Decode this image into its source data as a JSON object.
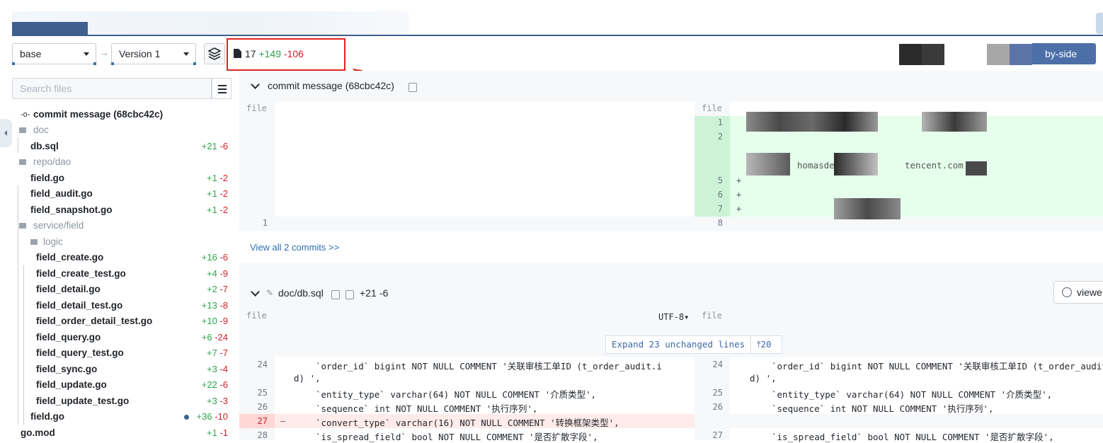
{
  "toolbar": {
    "base_select": "base",
    "version_select": "Version 1",
    "files_changed": "17",
    "additions": "+149",
    "deletions": "-106",
    "view_mode_label": "by-side"
  },
  "sidebar": {
    "search_placeholder": "Search files",
    "commit_message": "commit message (68cbc42c)",
    "items": [
      {
        "label": "doc",
        "type": "dir",
        "add": "",
        "del": ""
      },
      {
        "label": "db.sql",
        "type": "file",
        "add": "+21",
        "del": "-6"
      },
      {
        "label": "repo/dao",
        "type": "dir",
        "add": "",
        "del": ""
      },
      {
        "label": "field.go",
        "type": "file",
        "add": "+1",
        "del": "-2"
      },
      {
        "label": "field_audit.go",
        "type": "file",
        "add": "+1",
        "del": "-2"
      },
      {
        "label": "field_snapshot.go",
        "type": "file",
        "add": "+1",
        "del": "-2"
      },
      {
        "label": "service/field",
        "type": "dir",
        "add": "",
        "del": ""
      },
      {
        "label": "logic",
        "type": "dir",
        "add": "",
        "del": ""
      },
      {
        "label": "field_create.go",
        "type": "file",
        "add": "+16",
        "del": "-6"
      },
      {
        "label": "field_create_test.go",
        "type": "file",
        "add": "+4",
        "del": "-9"
      },
      {
        "label": "field_detail.go",
        "type": "file",
        "add": "+2",
        "del": "-7"
      },
      {
        "label": "field_detail_test.go",
        "type": "file",
        "add": "+13",
        "del": "-8"
      },
      {
        "label": "field_order_detail_test.go",
        "type": "file",
        "add": "+10",
        "del": "-9"
      },
      {
        "label": "field_query.go",
        "type": "file",
        "add": "+6",
        "del": "-24"
      },
      {
        "label": "field_query_test.go",
        "type": "file",
        "add": "+7",
        "del": "-7"
      },
      {
        "label": "field_sync.go",
        "type": "file",
        "add": "+3",
        "del": "-4"
      },
      {
        "label": "field_update.go",
        "type": "file",
        "add": "+22",
        "del": "-6"
      },
      {
        "label": "field_update_test.go",
        "type": "file",
        "add": "+3",
        "del": "-3"
      },
      {
        "label": "field.go",
        "type": "file",
        "add": "+36",
        "del": "-10"
      },
      {
        "label": "go.mod",
        "type": "file",
        "add": "+1",
        "del": "-1"
      }
    ]
  },
  "commit_panel": {
    "title": "commit message (68cbc42c)",
    "left_header": "file",
    "right_header": "file",
    "left_line": "1",
    "right_lines": [
      "1",
      "2",
      "5",
      "6",
      "7",
      "8"
    ],
    "visible_text_1": "homasdenq",
    "visible_text_2": "tencent.com",
    "view_all": "View all 2 commits >>"
  },
  "file_panel": {
    "title": "doc/db.sql",
    "additions": "+21",
    "deletions": "-6",
    "left_header": "file",
    "right_header": "file",
    "encoding": "UTF-8",
    "expand_label": "Expand 23 unchanged lines",
    "expand_up": "20",
    "viewed_label": "viewe",
    "lines": [
      {
        "l": "24",
        "r": "24",
        "code": "`order_id` bigint NOT NULL COMMENT '关联审核工单ID (t_order_audit.i",
        "cont": "d) ',"
      },
      {
        "l": "25",
        "r": "25",
        "code": "`entity_type` varchar(64) NOT NULL COMMENT '介质类型',"
      },
      {
        "l": "26",
        "r": "26",
        "code": "`sequence` int NOT NULL COMMENT '执行序列',"
      },
      {
        "l": "27",
        "r": "",
        "code": "`convert_type` varchar(16) NOT NULL COMMENT '转换框架类型',"
      },
      {
        "l": "28",
        "r": "27",
        "code": "`is_spread_field` bool NOT NULL COMMENT '是否扩散字段',"
      }
    ],
    "right_first_line": "`order_id` bigint NOT NULL COMMENT '关联审核工单ID (t_order_audit"
  },
  "colors": {
    "accent": "#3f5f8f",
    "addition": "#2da44e",
    "deletion": "#cf222e",
    "highlight_box": "#e02424",
    "added_bg": "#e6ffec",
    "deleted_bg": "#ffebe9"
  }
}
